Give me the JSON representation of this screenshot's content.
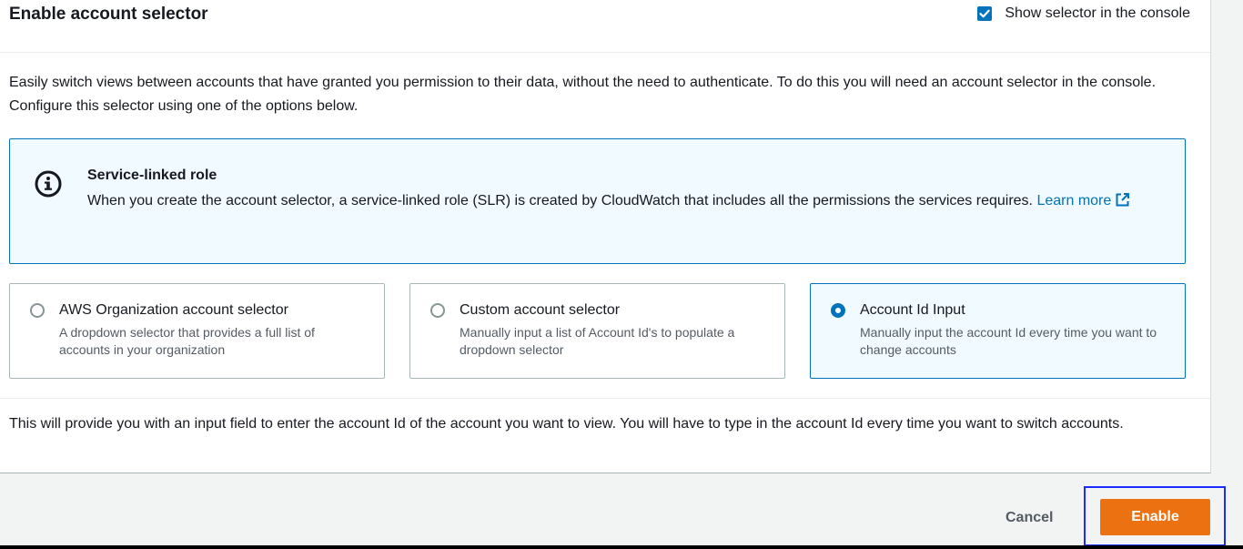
{
  "panel": {
    "title": "Enable account selector",
    "show_selector": {
      "label": "Show selector in the console",
      "checked": true
    },
    "intro": "Easily switch views between accounts that have granted you permission to their data, without the need to authenticate. To do this you will need an account selector in the console. Configure this selector using one of the options below."
  },
  "info": {
    "icon": "info-icon",
    "title": "Service-linked role",
    "body": "When you create the account selector, a service-linked role (SLR) is created by CloudWatch that includes all the permissions the services requires.",
    "link_label": "Learn more",
    "link_icon": "external-link-icon"
  },
  "options": [
    {
      "title": "AWS Organization account selector",
      "description": "A dropdown selector that provides a full list of accounts in your organization",
      "selected": false
    },
    {
      "title": "Custom account selector",
      "description": "Manually input a list of Account Id's to populate a dropdown selector",
      "selected": false
    },
    {
      "title": "Account Id Input",
      "description": "Manually input the account Id every time you want to change accounts",
      "selected": true
    }
  ],
  "note": "This will provide you with an input field to enter the account Id of the account you want to view. You will have to type in the account Id every time you want to switch accounts.",
  "footer": {
    "cancel_label": "Cancel",
    "enable_label": "Enable"
  },
  "colors": {
    "primary_blue": "#0073bb",
    "enable_orange": "#ec7211",
    "info_bg": "#f1faff"
  }
}
